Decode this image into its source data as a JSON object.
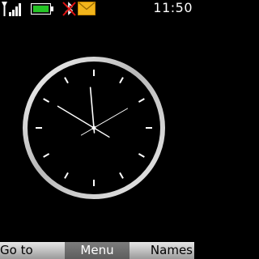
{
  "status_bar": {
    "time": "11:50",
    "icons": [
      "signal-strength-icon",
      "battery-icon",
      "bluetooth-off-icon",
      "envelope-icon"
    ],
    "colors": {
      "battery": "#25c425",
      "envelope": "#f2b51c",
      "bluetooth_cross": "#e01010"
    }
  },
  "clock": {
    "hour": 11,
    "minute": 50,
    "second": 10,
    "ring_color": "#d8d8d8"
  },
  "softkeys": {
    "left": "Go to",
    "middle": "Menu",
    "right": "Names"
  }
}
